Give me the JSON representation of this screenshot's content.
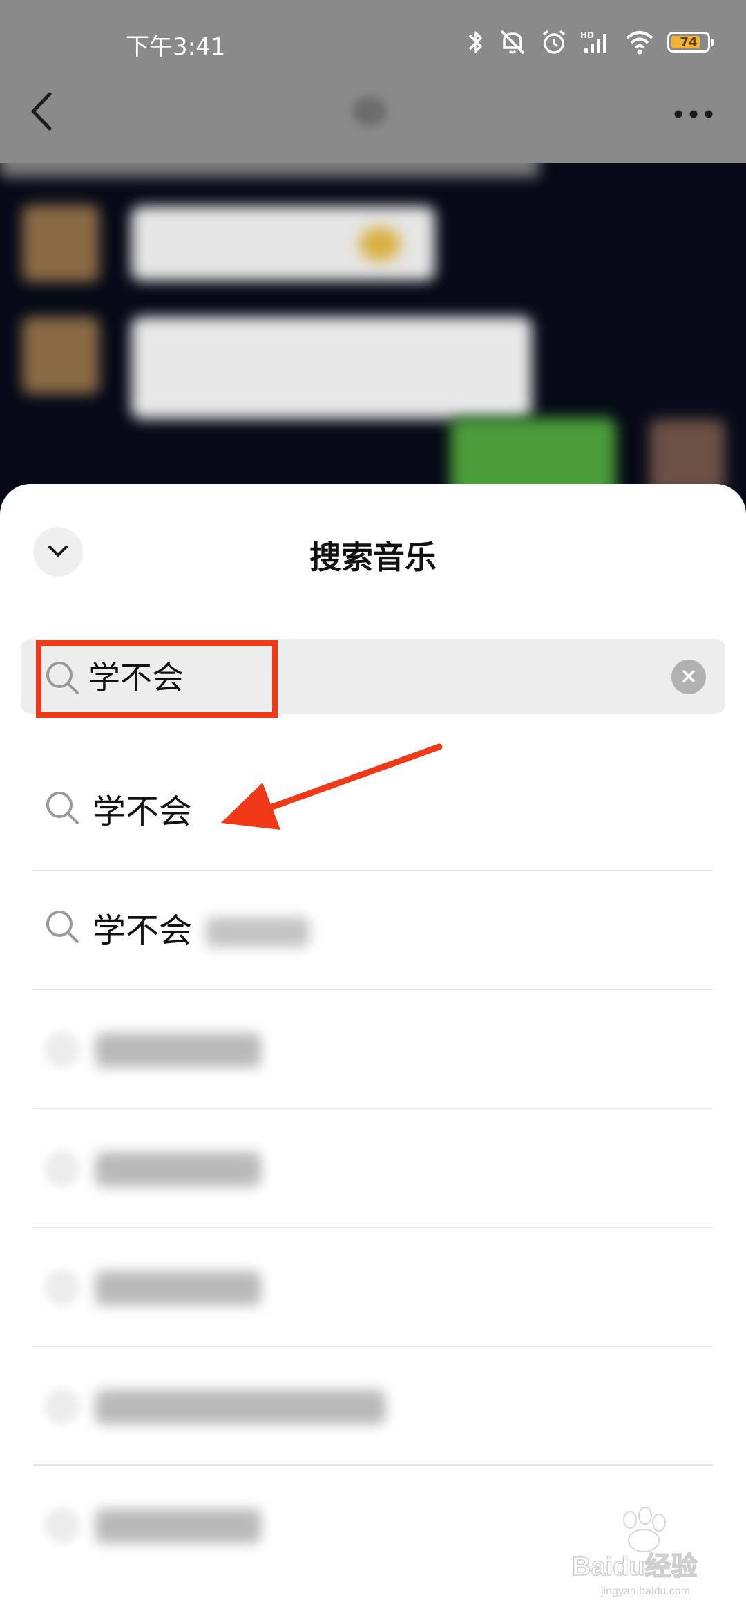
{
  "status_bar": {
    "time": "下午3:41",
    "battery_level": "74",
    "battery_percent": 74,
    "icons": [
      "bluetooth-icon",
      "mute-icon",
      "alarm-icon",
      "hd-signal-icon",
      "wifi-icon",
      "battery-icon"
    ]
  },
  "chat_header": {
    "icons": [
      "back-icon",
      "more-icon"
    ]
  },
  "sheet": {
    "title": "搜索音乐",
    "collapse_icon": "chevron-down-icon"
  },
  "search": {
    "value": "学不会",
    "icon": "search-icon",
    "clear_icon": "clear-icon"
  },
  "suggestions": [
    {
      "text": "学不会"
    },
    {
      "text": "学不会"
    }
  ],
  "annotations": {
    "highlight_color": "#f03a17"
  },
  "watermark": {
    "text": "Baidu经验",
    "url": "jingyan.baidu.com"
  }
}
